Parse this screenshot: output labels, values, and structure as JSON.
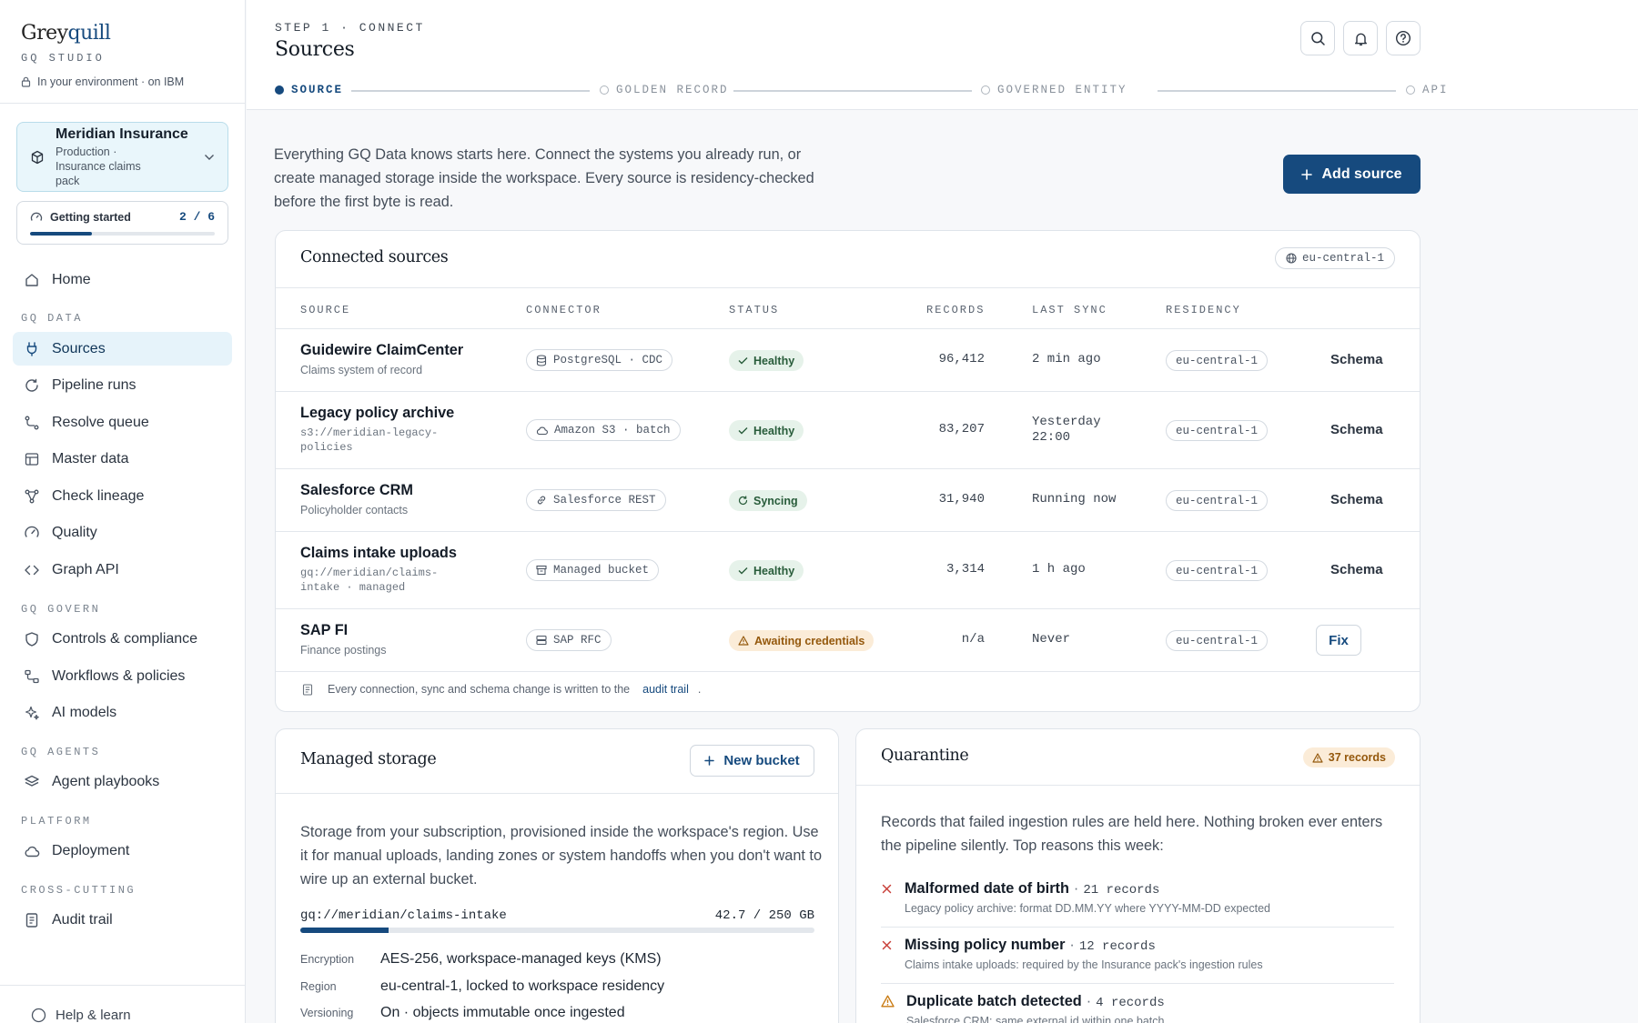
{
  "brand": {
    "name_first": "Grey",
    "name_second": "quill",
    "product": "GQ STUDIO",
    "environment": "In your environment · on IBM"
  },
  "workspace": {
    "title": "Meridian Insurance",
    "subtitle": "Production · Insurance claims pack"
  },
  "getting_started": {
    "label": "Getting started",
    "count": "2 / 6",
    "progress_fraction": 0.333
  },
  "nav": {
    "home": "Home",
    "sections": {
      "gq_data": "GQ DATA",
      "gq_govern": "GQ GOVERN",
      "gq_agents": "GQ AGENTS",
      "platform": "PLATFORM",
      "cross_cutting": "CROSS-CUTTING"
    },
    "items": {
      "sources": "Sources",
      "pipeline_runs": "Pipeline runs",
      "resolve_queue": "Resolve queue",
      "master_data": "Master data",
      "check_lineage": "Check lineage",
      "quality": "Quality",
      "graph_api": "Graph API",
      "controls": "Controls & compliance",
      "workflows": "Workflows & policies",
      "ai_models": "AI models",
      "agent_playbooks": "Agent playbooks",
      "deployment": "Deployment",
      "audit_trail": "Audit trail"
    },
    "help": "Help & learn"
  },
  "header": {
    "kicker": "STEP 1 · CONNECT",
    "title": "Sources",
    "steps": [
      "SOURCE",
      "GOLDEN RECORD",
      "GOVERNED ENTITY",
      "API"
    ],
    "active_step": 0
  },
  "intro": "Everything GQ Data knows starts here. Connect the systems you already run, or create managed storage inside the workspace. Every source is residency-checked before the first byte is read.",
  "add_source_label": "Add source",
  "connected": {
    "title": "Connected sources",
    "region": "eu-central-1",
    "columns": [
      "SOURCE",
      "CONNECTOR",
      "STATUS",
      "RECORDS",
      "LAST SYNC",
      "RESIDENCY"
    ],
    "rows": [
      {
        "name": "Guidewire ClaimCenter",
        "sub": "Claims system of record",
        "connector": "PostgreSQL · CDC",
        "status": "Healthy",
        "records": "96,412",
        "last_sync": "2 min ago",
        "residency": "eu-central-1",
        "action": "Schema"
      },
      {
        "name": "Legacy policy archive",
        "sub": "s3://meridian-legacy-policies",
        "connector": "Amazon S3 · batch",
        "status": "Healthy",
        "records": "83,207",
        "last_sync": "Yesterday 22:00",
        "residency": "eu-central-1",
        "action": "Schema"
      },
      {
        "name": "Salesforce CRM",
        "sub": "Policyholder contacts",
        "connector": "Salesforce REST",
        "status": "Syncing",
        "records": "31,940",
        "last_sync": "Running now",
        "residency": "eu-central-1",
        "action": "Schema"
      },
      {
        "name": "Claims intake uploads",
        "sub": "gq://meridian/claims-intake · managed",
        "connector": "Managed bucket",
        "status": "Healthy",
        "records": "3,314",
        "last_sync": "1 h ago",
        "residency": "eu-central-1",
        "action": "Schema"
      },
      {
        "name": "SAP FI",
        "sub": "Finance postings",
        "connector": "SAP RFC",
        "status": "Awaiting credentials",
        "records": "n/a",
        "last_sync": "Never",
        "residency": "eu-central-1",
        "action": "Fix"
      }
    ],
    "audit_note": "Every connection, sync and schema change is written to the",
    "audit_link": "audit trail",
    "audit_end": "."
  },
  "storage": {
    "title": "Managed storage",
    "new_bucket": "New bucket",
    "description": "Storage from your subscription, provisioned inside the workspace's region. Use it for manual uploads, landing zones or system handoffs when you don't want to wire up an external bucket.",
    "bucket": "gq://meridian/claims-intake",
    "usage": "42.7 / 250 GB",
    "usage_fraction": 0.171,
    "details": [
      {
        "k": "Encryption",
        "v": "AES-256, workspace-managed keys (KMS)"
      },
      {
        "k": "Region",
        "v": "eu-central-1, locked to workspace residency"
      },
      {
        "k": "Versioning",
        "v": "On · objects immutable once ingested"
      }
    ]
  },
  "quarantine": {
    "title": "Quarantine",
    "badge": "37 records",
    "description": "Records that failed ingestion rules are held here. Nothing broken ever enters the pipeline silently. Top reasons this week:",
    "items": [
      {
        "title": "Malformed date of birth",
        "count": "21 records",
        "sub": "Legacy policy archive: format DD.MM.YY where YYYY-MM-DD expected",
        "kind": "error"
      },
      {
        "title": "Missing policy number",
        "count": "12 records",
        "sub": "Claims intake uploads: required by the Insurance pack's ingestion rules",
        "kind": "error"
      },
      {
        "title": "Duplicate batch detected",
        "count": "4 records",
        "sub": "Salesforce CRM: same external id within one batch",
        "kind": "warning"
      }
    ]
  },
  "colors": {
    "primary": "#164a7e",
    "healthy_bg": "#e6f2ea",
    "warn_bg": "#fbecd8",
    "error": "#c9403a",
    "warning": "#c97a12"
  }
}
